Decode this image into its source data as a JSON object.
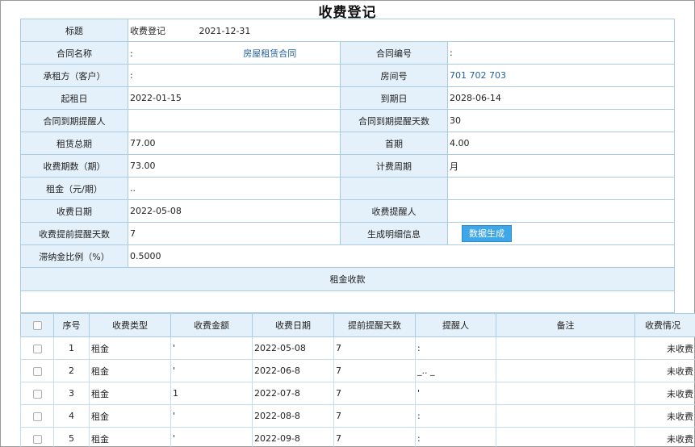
{
  "page": {
    "title": "收费登记"
  },
  "form": {
    "title_label": "标题",
    "title_value": "收费登记",
    "title_date": "2021-12-31",
    "contract_name_label": "合同名称",
    "contract_name_prefix": ":",
    "contract_name_value": "房屋租赁合同",
    "contract_no_label": "合同编号",
    "contract_no_value": ":",
    "tenant_label": "承租方（客户）",
    "tenant_value": ":",
    "room_no_label": "房间号",
    "room_no_value": "701 702 703",
    "start_date_label": "起租日",
    "start_date_value": "2022-01-15",
    "end_date_label": "到期日",
    "end_date_value": "2028-06-14",
    "expiry_reminder_label": "合同到期提醒人",
    "expiry_reminder_value": "",
    "expiry_days_label": "合同到期提醒天数",
    "expiry_days_value": "30",
    "total_periods_label": "租赁总期",
    "total_periods_value": "77.00",
    "first_period_label": "首期",
    "first_period_value": "4.00",
    "charge_periods_label": "收费期数（期）",
    "charge_periods_value": "73.00",
    "billing_cycle_label": "计费周期",
    "billing_cycle_value": "月",
    "rent_label": "租金（元/期）",
    "rent_value": "..",
    "charge_date_label": "收费日期",
    "charge_date_value": "2022-05-08",
    "charge_reminder_label": "收费提醒人",
    "charge_reminder_value": "",
    "advance_days_label": "收费提前提醒天数",
    "advance_days_value": "7",
    "generate_label": "生成明细信息",
    "generate_button": "数据生成",
    "late_fee_label": "滞纳金比例（%）",
    "late_fee_value": "0.5000",
    "section_title": "租金收款"
  },
  "grid": {
    "headers": [
      "序号",
      "收费类型",
      "收费金额",
      "收费日期",
      "提前提醒天数",
      "提醒人",
      "备注",
      "收费情况"
    ],
    "rows": [
      {
        "no": "1",
        "type": "租金",
        "amount": "'",
        "date": "2022-05-08",
        "days": "7",
        "reminder": ":",
        "note": "",
        "status": "未收费"
      },
      {
        "no": "2",
        "type": "租金",
        "amount": "'",
        "date": "2022-06-8",
        "days": "7",
        "reminder": "_.. _",
        "note": "",
        "status": "未收费"
      },
      {
        "no": "3",
        "type": "租金",
        "amount": "1",
        "date": "2022-07-8",
        "days": "7",
        "reminder": "'",
        "note": "",
        "status": "未收费"
      },
      {
        "no": "4",
        "type": "租金",
        "amount": "'",
        "date": "2022-08-8",
        "days": "7",
        "reminder": ":",
        "note": "",
        "status": "未收费"
      },
      {
        "no": "5",
        "type": "租金",
        "amount": "'",
        "date": "2022-09-8",
        "days": "7",
        "reminder": ":",
        "note": "",
        "status": "未收费"
      }
    ]
  }
}
